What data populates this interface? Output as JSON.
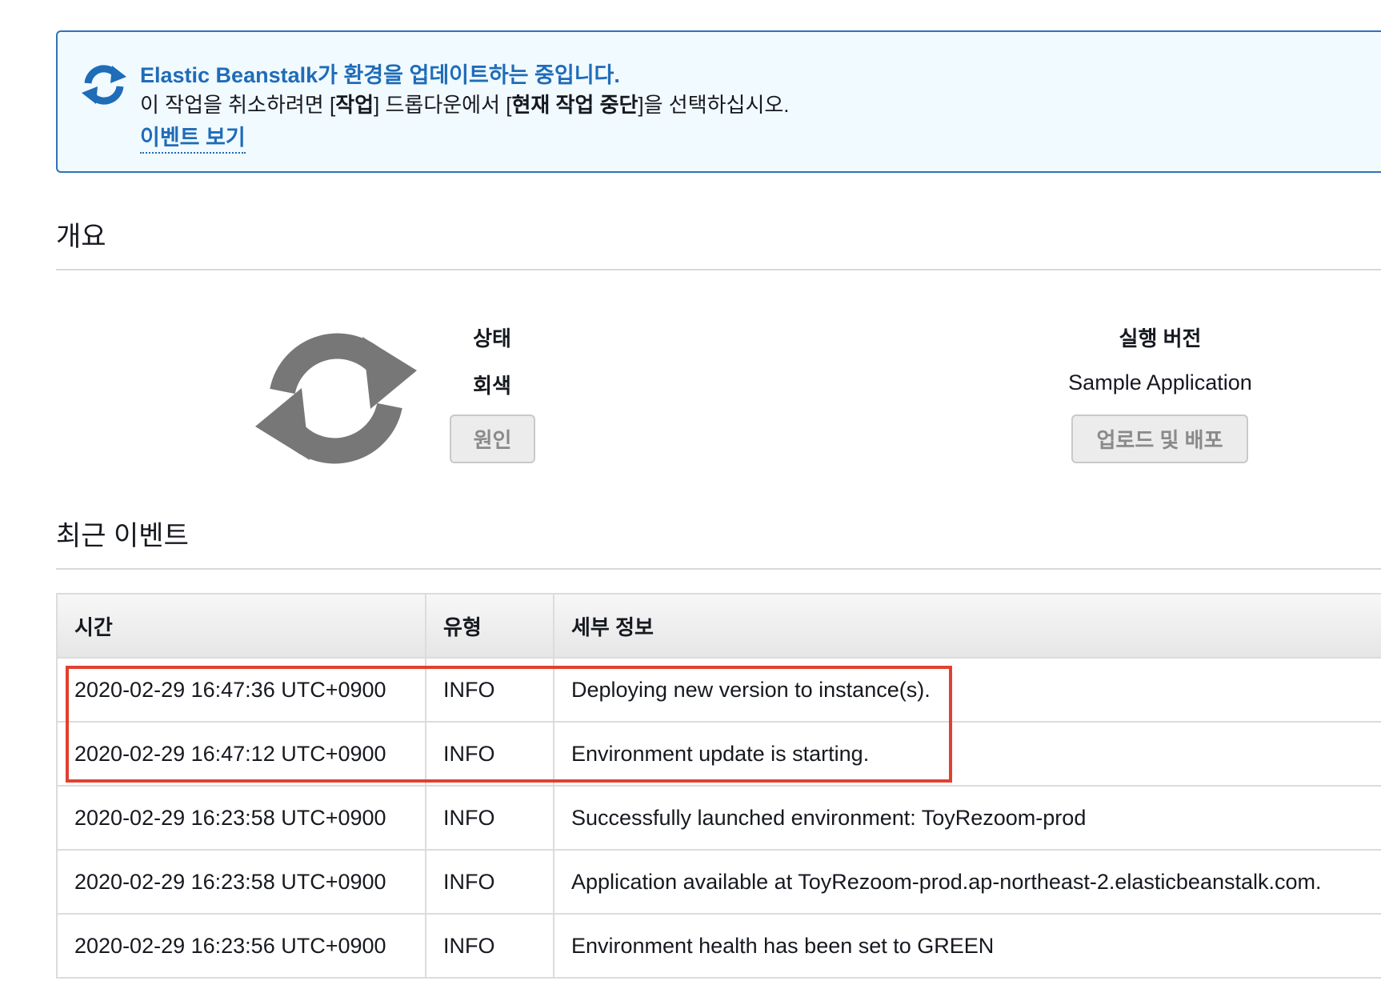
{
  "banner": {
    "title": "Elastic Beanstalk가 환경을 업데이트하는 중입니다.",
    "message_prefix": "이 작업을 취소하려면 [",
    "message_action": "작업",
    "message_middle": "] 드롭다운에서 [",
    "message_abort": "현재 작업 중단",
    "message_suffix": "]을 선택하십시오.",
    "link_label": "이벤트 보기",
    "icon": "refresh-icon",
    "accent_color": "#1f6cb8"
  },
  "overview": {
    "title": "개요",
    "icon": "refresh-icon",
    "status_label": "상태",
    "status_value": "회색",
    "cause_button": "원인",
    "version_label": "실행 버전",
    "version_value": "Sample Application",
    "upload_button": "업로드 및 배포"
  },
  "events": {
    "title": "최근 이벤트",
    "columns": {
      "time": "시간",
      "type": "유형",
      "details": "세부 정보"
    },
    "rows": [
      {
        "time": "2020-02-29 16:47:36 UTC+0900",
        "type": "INFO",
        "details": "Deploying new version to instance(s)."
      },
      {
        "time": "2020-02-29 16:47:12 UTC+0900",
        "type": "INFO",
        "details": "Environment update is starting."
      },
      {
        "time": "2020-02-29 16:23:58 UTC+0900",
        "type": "INFO",
        "details": "Successfully launched environment: ToyRezoom-prod"
      },
      {
        "time": "2020-02-29 16:23:58 UTC+0900",
        "type": "INFO",
        "details": "Application available at ToyRezoom-prod.ap-northeast-2.elasticbeanstalk.com."
      },
      {
        "time": "2020-02-29 16:23:56 UTC+0900",
        "type": "INFO",
        "details": "Environment health has been set to GREEN"
      }
    ],
    "info_color": "#5a8f1c",
    "highlight_color": "#e0412f"
  }
}
